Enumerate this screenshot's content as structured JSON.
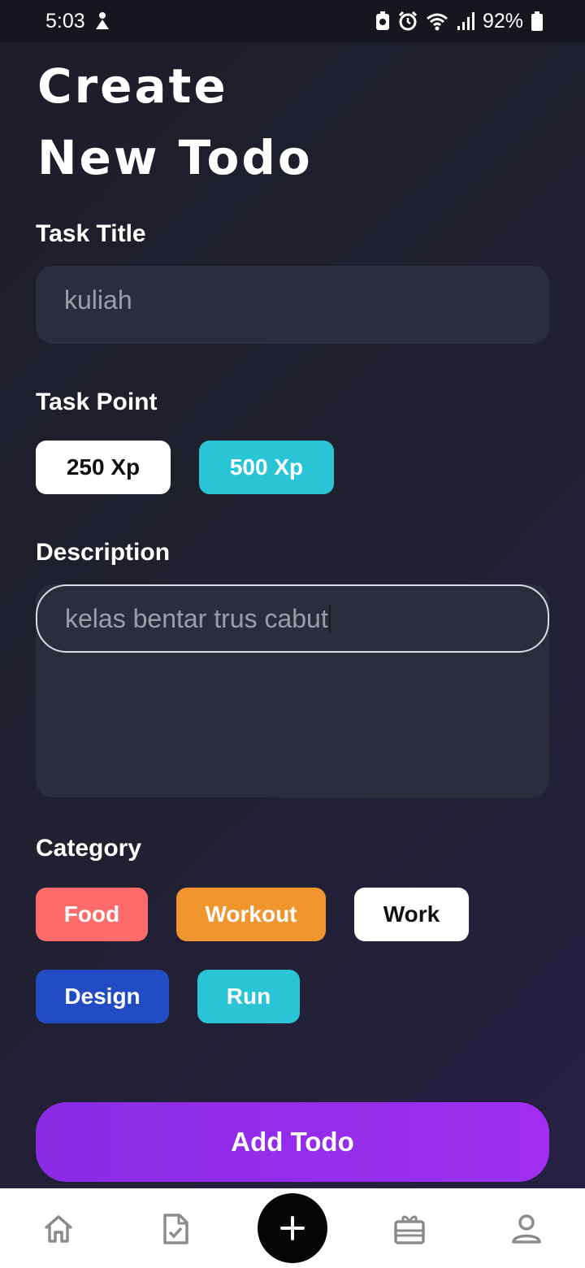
{
  "status_bar": {
    "time": "5:03",
    "battery": "92%",
    "icons": [
      "person-icon",
      "battery-saver-icon",
      "alarm-icon",
      "wifi-icon",
      "signal-icon",
      "battery-icon"
    ]
  },
  "header": {
    "title_line1": "Create",
    "title_line2": "New Todo"
  },
  "form": {
    "task_title_label": "Task Title",
    "task_title_value": "kuliah",
    "task_point_label": "Task Point",
    "points": [
      {
        "label": "250 Xp",
        "selected": true,
        "color": "#ffffff"
      },
      {
        "label": "500 Xp",
        "selected": false,
        "color": "#29c5d6"
      }
    ],
    "description_label": "Description",
    "description_value": "kelas bentar trus cabut",
    "category_label": "Category",
    "categories": [
      {
        "label": "Food",
        "color": "#fd6b6b",
        "selected": false
      },
      {
        "label": "Workout",
        "color": "#f1952f",
        "selected": false
      },
      {
        "label": "Work",
        "color": "#ffffff",
        "selected": true
      },
      {
        "label": "Design",
        "color": "#214cc4",
        "selected": false
      },
      {
        "label": "Run",
        "color": "#29c5d6",
        "selected": false
      }
    ]
  },
  "actions": {
    "add_label": "Add Todo",
    "add_color": "#9a2ef0"
  },
  "bottom_nav": {
    "items": [
      "home-icon",
      "task-icon",
      "add-icon",
      "reward-icon",
      "profile-icon"
    ]
  }
}
